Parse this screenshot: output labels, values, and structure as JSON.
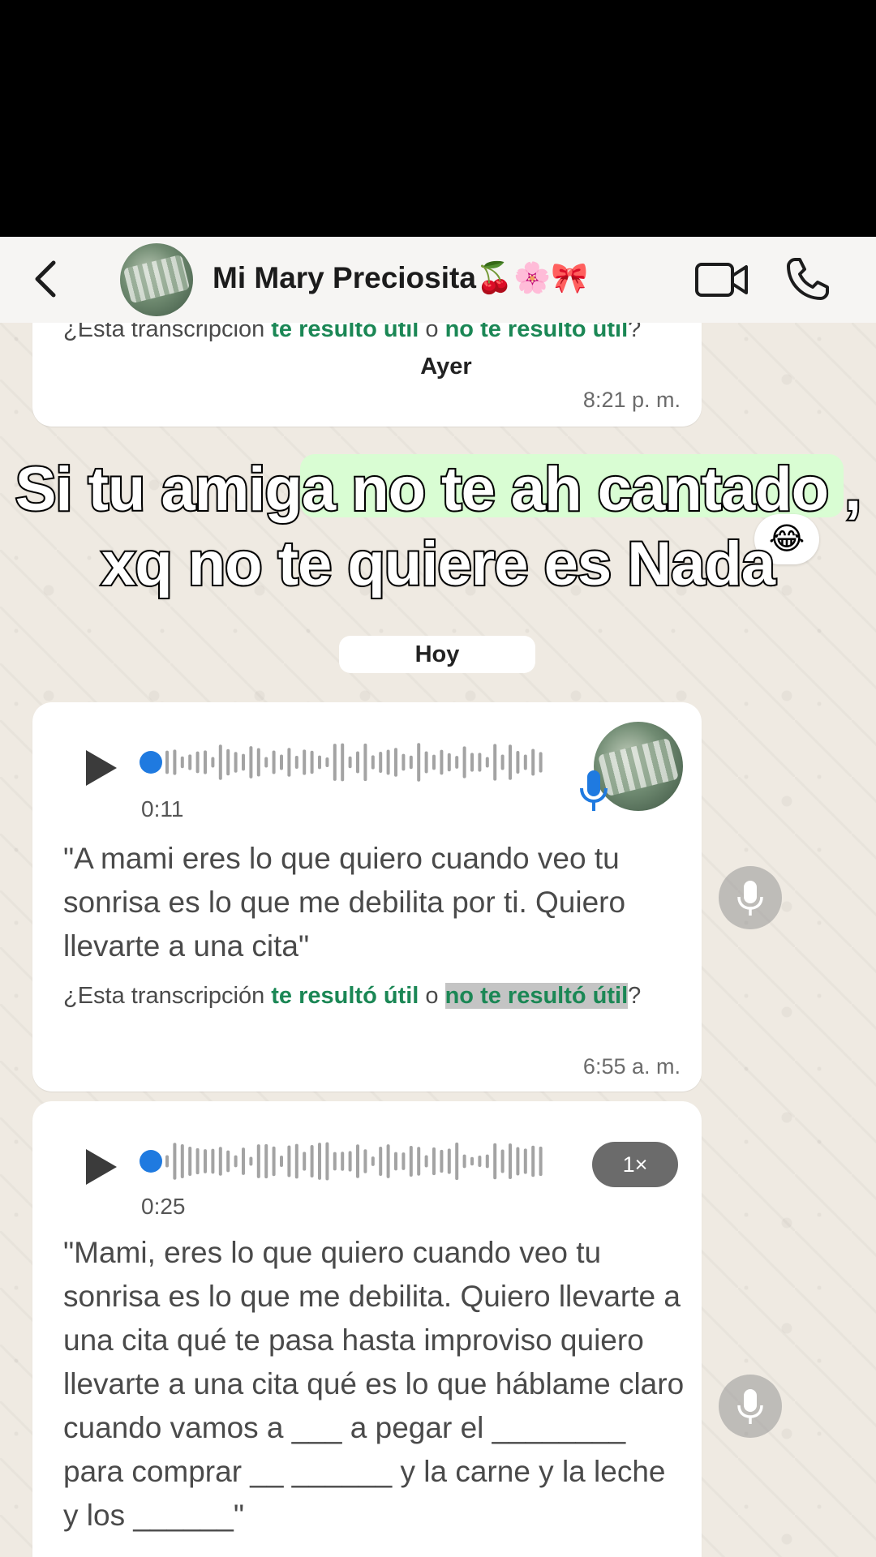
{
  "header": {
    "contact_name": "Mi Mary Preciosita🍒🌸🎀"
  },
  "caption": {
    "line1": "Si tu amiga no te ah cantado ,",
    "line2": "xq no te quiere es Nada"
  },
  "chat": {
    "prev_message": {
      "question_prefix": "¿Esta transcripción ",
      "useful": "te resultó útil",
      "or": " o ",
      "not_useful": "no te resultó útil",
      "suffix": "?",
      "time": "8:21 p. m."
    },
    "date_ayer": "Ayer",
    "reaction_emoji": "😂",
    "date_hoy": "Hoy",
    "voice1": {
      "duration": "0:11",
      "transcript": "\"A mami eres lo que quiero cuando veo tu sonrisa es lo que me debilita por ti. Quiero llevarte a una cita\"",
      "question_prefix": "¿Esta transcripción ",
      "useful": "te resultó útil",
      "or": " o ",
      "not_useful": "no te resultó útil",
      "suffix": "?",
      "time": "6:55 a. m."
    },
    "voice2": {
      "duration": "0:25",
      "speed": "1×",
      "transcript": "\"Mami, eres lo que quiero cuando veo tu sonrisa es lo que me debilita. Quiero llevarte a una cita qué te pasa hasta improviso quiero llevarte a una cita qué es lo que háblame claro cuando vamos a ___ a pegar el ________ para comprar __ ______ y la carne y la leche y los ______\""
    }
  },
  "icons": {
    "back": "chevron-left-icon",
    "video": "video-camera-icon",
    "call": "phone-icon",
    "play": "play-icon",
    "mic": "microphone-icon"
  },
  "colors": {
    "header_bg": "#f6f5f3",
    "chat_bg": "#efeae2",
    "link_green": "#1b8755",
    "progress_blue": "#1f7ae0"
  }
}
